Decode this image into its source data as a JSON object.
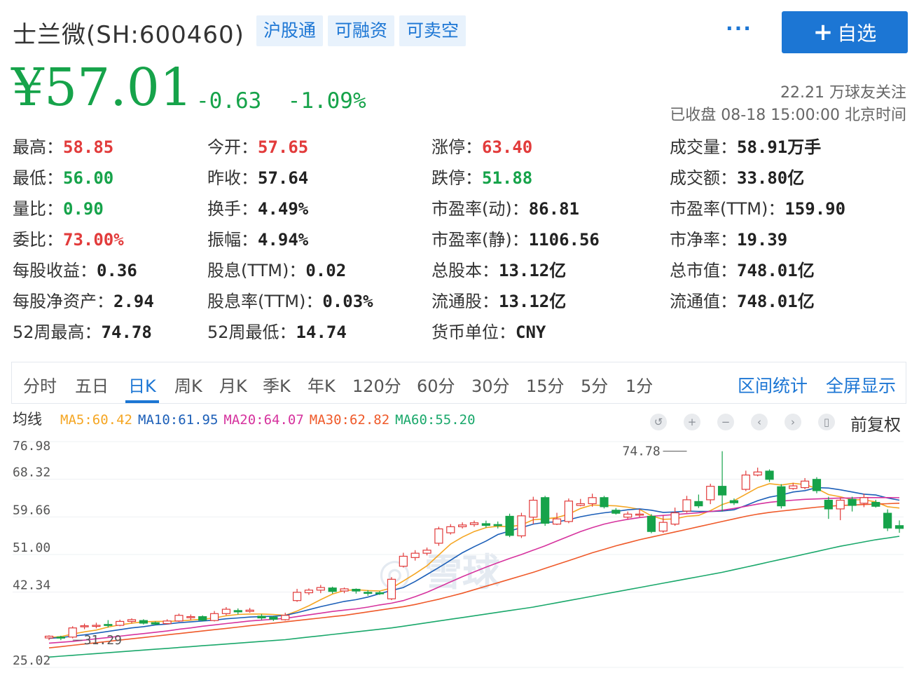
{
  "header": {
    "title": "士兰微(SH:600460)",
    "tags": [
      "沪股通",
      "可融资",
      "可卖空"
    ],
    "more_label": "···",
    "follow_button": "自选",
    "follow_icon": "+"
  },
  "quote": {
    "price": "¥57.01",
    "change": "-0.63",
    "change_pct": "-1.09%",
    "followers": "22.21 万球友关注",
    "status": "已收盘 08-18 15:00:00 北京时间"
  },
  "stats": [
    [
      {
        "label": "最高：",
        "value": "58.85",
        "color": "red"
      },
      {
        "label": "今开：",
        "value": "57.65",
        "color": "red"
      },
      {
        "label": "涨停：",
        "value": "63.40",
        "color": "red"
      },
      {
        "label": "成交量：",
        "value": "58.91万手",
        "color": "dark"
      }
    ],
    [
      {
        "label": "最低：",
        "value": "56.00",
        "color": "green"
      },
      {
        "label": "昨收：",
        "value": "57.64",
        "color": "dark"
      },
      {
        "label": "跌停：",
        "value": "51.88",
        "color": "green"
      },
      {
        "label": "成交额：",
        "value": "33.80亿",
        "color": "dark"
      }
    ],
    [
      {
        "label": "量比：",
        "value": "0.90",
        "color": "green"
      },
      {
        "label": "换手：",
        "value": "4.49%",
        "color": "dark"
      },
      {
        "label": "市盈率(动)：",
        "value": "86.81",
        "color": "dark"
      },
      {
        "label": "市盈率(TTM)：",
        "value": "159.90",
        "color": "dark"
      }
    ],
    [
      {
        "label": "委比：",
        "value": "73.00%",
        "color": "red"
      },
      {
        "label": "振幅：",
        "value": "4.94%",
        "color": "dark"
      },
      {
        "label": "市盈率(静)：",
        "value": "1106.56",
        "color": "dark"
      },
      {
        "label": "市净率：",
        "value": "19.39",
        "color": "dark"
      }
    ],
    [
      {
        "label": "每股收益：",
        "value": "0.36",
        "color": "dark"
      },
      {
        "label": "股息(TTM)：",
        "value": "0.02",
        "color": "dark"
      },
      {
        "label": "总股本：",
        "value": "13.12亿",
        "color": "dark"
      },
      {
        "label": "总市值：",
        "value": "748.01亿",
        "color": "dark"
      }
    ],
    [
      {
        "label": "每股净资产：",
        "value": "2.94",
        "color": "dark"
      },
      {
        "label": "股息率(TTM)：",
        "value": "0.03%",
        "color": "dark"
      },
      {
        "label": "流通股：",
        "value": "13.12亿",
        "color": "dark"
      },
      {
        "label": "流通值：",
        "value": "748.01亿",
        "color": "dark"
      }
    ],
    [
      {
        "label": "52周最高：",
        "value": "74.78",
        "color": "dark"
      },
      {
        "label": "52周最低：",
        "value": "14.74",
        "color": "dark"
      },
      {
        "label": "货币单位：",
        "value": "CNY",
        "color": "dark"
      }
    ]
  ],
  "tabs": [
    "分时",
    "五日",
    "日K",
    "周K",
    "月K",
    "季K",
    "年K",
    "120分",
    "60分",
    "30分",
    "15分",
    "5分",
    "1分"
  ],
  "active_tab": "日K",
  "tab_links": [
    "区间统计",
    "全屏显示"
  ],
  "ma_bar": {
    "label": "均线",
    "items": [
      {
        "text": "MA5:60.42",
        "color": "#f5a623"
      },
      {
        "text": "MA10:61.95",
        "color": "#1c5fb8"
      },
      {
        "text": "MA20:64.07",
        "color": "#d6339e"
      },
      {
        "text": "MA30:62.82",
        "color": "#ef5a2a"
      },
      {
        "text": "MA60:55.20",
        "color": "#1aa86b"
      }
    ]
  },
  "chart_controls": [
    "undo-icon",
    "zoom-in-icon",
    "zoom-out-icon",
    "left-icon",
    "right-icon",
    "fullscreen-icon"
  ],
  "adjust_label": "前复权",
  "watermark": "雪球",
  "chart_data": {
    "type": "candlestick",
    "y_ticks": [
      "76.98",
      "68.32",
      "59.66",
      "51.00",
      "42.34",
      "25.02"
    ],
    "ylim": [
      25.02,
      76.98
    ],
    "annotations": [
      {
        "text": "74.78",
        "value": 74.78,
        "index": 54
      },
      {
        "text": "31.29",
        "value": 31.29,
        "index": 2
      }
    ],
    "candles": [
      [
        31.8,
        32.2,
        31.3,
        32.4
      ],
      [
        32.0,
        31.9,
        31.29,
        32.3
      ],
      [
        32.0,
        34.1,
        31.7,
        34.5
      ],
      [
        34.4,
        34.6,
        33.8,
        35.1
      ],
      [
        34.6,
        34.7,
        34.0,
        35.3
      ],
      [
        34.9,
        34.8,
        34.2,
        35.9
      ],
      [
        34.7,
        35.6,
        34.5,
        36.0
      ],
      [
        35.6,
        36.0,
        35.1,
        36.3
      ],
      [
        35.8,
        35.2,
        34.9,
        36.1
      ],
      [
        35.3,
        35.0,
        34.7,
        35.6
      ],
      [
        35.1,
        35.7,
        34.9,
        36.1
      ],
      [
        35.7,
        37.0,
        35.5,
        37.4
      ],
      [
        36.6,
        36.7,
        35.9,
        37.2
      ],
      [
        36.7,
        35.9,
        35.6,
        37.0
      ],
      [
        35.8,
        37.4,
        35.6,
        38.0
      ],
      [
        37.4,
        38.4,
        37.0,
        38.9
      ],
      [
        38.1,
        37.8,
        37.2,
        38.6
      ],
      [
        37.9,
        38.2,
        37.6,
        38.7
      ],
      [
        36.8,
        36.4,
        35.9,
        37.3
      ],
      [
        36.6,
        36.1,
        35.7,
        36.9
      ],
      [
        36.0,
        37.0,
        35.8,
        37.6
      ],
      [
        40.4,
        42.3,
        40.1,
        43.1
      ],
      [
        42.2,
        42.8,
        41.7,
        43.2
      ],
      [
        42.8,
        43.4,
        42.1,
        44.0
      ],
      [
        43.3,
        42.5,
        42.0,
        43.6
      ],
      [
        42.6,
        43.1,
        42.1,
        43.4
      ],
      [
        43.0,
        42.6,
        42.0,
        43.2
      ],
      [
        42.3,
        42.2,
        41.5,
        42.8
      ],
      [
        42.2,
        42.0,
        41.7,
        42.6
      ],
      [
        40.8,
        45.3,
        40.5,
        45.8
      ],
      [
        48.3,
        50.6,
        48.0,
        51.4
      ],
      [
        50.3,
        51.3,
        49.6,
        52.0
      ],
      [
        51.3,
        52.0,
        50.8,
        52.6
      ],
      [
        53.6,
        56.9,
        53.0,
        57.4
      ],
      [
        56.0,
        57.4,
        55.6,
        58.0
      ],
      [
        57.4,
        57.8,
        57.0,
        58.4
      ],
      [
        57.9,
        58.3,
        57.4,
        58.8
      ],
      [
        58.1,
        57.7,
        57.2,
        58.8
      ],
      [
        57.9,
        57.7,
        57.0,
        58.6
      ],
      [
        59.8,
        55.4,
        55.0,
        60.4
      ],
      [
        55.3,
        59.9,
        54.8,
        60.6
      ],
      [
        59.6,
        63.5,
        58.0,
        64.3
      ],
      [
        64.1,
        58.2,
        57.6,
        64.5
      ],
      [
        58.0,
        59.2,
        57.8,
        60.6
      ],
      [
        58.6,
        63.3,
        58.2,
        63.9
      ],
      [
        62.3,
        62.7,
        62.1,
        63.8
      ],
      [
        62.7,
        64.1,
        62.0,
        65.0
      ],
      [
        64.1,
        62.0,
        61.6,
        64.5
      ],
      [
        61.2,
        60.5,
        60.2,
        61.7
      ],
      [
        59.6,
        60.3,
        59.1,
        60.9
      ],
      [
        60.1,
        60.3,
        59.6,
        61.5
      ],
      [
        59.8,
        56.3,
        55.9,
        60.3
      ],
      [
        56.4,
        58.4,
        56.0,
        60.0
      ],
      [
        58.0,
        60.6,
        57.6,
        61.8
      ],
      [
        61.0,
        63.6,
        60.6,
        64.5
      ],
      [
        63.2,
        62.2,
        61.7,
        64.8
      ],
      [
        63.6,
        66.7,
        62.6,
        67.3
      ],
      [
        66.7,
        64.7,
        60.9,
        74.78
      ],
      [
        63.4,
        62.9,
        62.4,
        63.9
      ],
      [
        66.0,
        69.3,
        65.6,
        70.3
      ],
      [
        69.3,
        70.0,
        69.0,
        71.0
      ],
      [
        70.2,
        68.3,
        67.7,
        70.6
      ],
      [
        66.6,
        62.2,
        61.6,
        67.2
      ],
      [
        66.2,
        66.8,
        65.9,
        67.5
      ],
      [
        66.4,
        67.9,
        66.0,
        68.6
      ],
      [
        68.3,
        65.7,
        65.1,
        68.8
      ],
      [
        63.5,
        61.5,
        59.2,
        64.3
      ],
      [
        61.5,
        63.5,
        58.9,
        64.1
      ],
      [
        63.7,
        62.3,
        60.9,
        64.3
      ],
      [
        62.8,
        64.1,
        61.9,
        65.0
      ],
      [
        63.0,
        62.1,
        61.8,
        63.6
      ],
      [
        60.5,
        57.1,
        56.4,
        61.4
      ],
      [
        57.65,
        57.01,
        56.0,
        58.85
      ]
    ],
    "ma_series": [
      {
        "name": "MA5",
        "color": "#f5a623",
        "values": [
          31.9,
          32.1,
          32.7,
          33.2,
          33.6,
          34.3,
          34.8,
          35.2,
          35.5,
          35.6,
          35.6,
          35.7,
          35.9,
          36.1,
          36.4,
          36.9,
          37.2,
          37.3,
          37.3,
          37.2,
          37.0,
          38.0,
          39.2,
          40.6,
          41.9,
          42.7,
          42.9,
          42.7,
          42.6,
          43.3,
          44.9,
          46.6,
          48.4,
          50.9,
          53.4,
          55.0,
          56.3,
          57.2,
          57.5,
          57.4,
          57.8,
          59.0,
          59.2,
          59.5,
          60.3,
          61.6,
          62.4,
          62.3,
          62.2,
          61.9,
          61.4,
          59.9,
          59.1,
          59.2,
          59.8,
          60.0,
          61.1,
          62.5,
          63.4,
          64.9,
          66.4,
          67.3,
          67.0,
          67.4,
          67.1,
          66.2,
          64.8,
          64.3,
          63.6,
          63.6,
          63.1,
          62.0,
          61.7
        ]
      },
      {
        "name": "MA10",
        "color": "#1c5fb8",
        "values": [
          31.7,
          31.9,
          32.2,
          32.5,
          32.9,
          33.3,
          33.7,
          34.1,
          34.4,
          34.8,
          35.0,
          35.3,
          35.5,
          35.7,
          35.9,
          36.2,
          36.4,
          36.6,
          36.7,
          36.8,
          37.0,
          37.6,
          38.3,
          39.0,
          39.6,
          40.2,
          40.6,
          41.2,
          42.0,
          42.7,
          43.4,
          44.8,
          46.4,
          48.0,
          49.7,
          51.4,
          52.8,
          54.1,
          55.6,
          56.4,
          57.2,
          58.0,
          58.4,
          58.5,
          59.0,
          59.7,
          60.2,
          60.6,
          60.9,
          61.3,
          61.5,
          61.2,
          60.7,
          60.8,
          61.0,
          60.9,
          60.9,
          61.0,
          61.3,
          62.3,
          63.4,
          64.2,
          64.7,
          65.4,
          65.7,
          66.4,
          66.3,
          65.9,
          65.4,
          64.9,
          64.7,
          64.0,
          63.5
        ]
      },
      {
        "name": "MA20",
        "color": "#d6339e",
        "values": [
          30.6,
          30.8,
          31.0,
          31.3,
          31.6,
          31.9,
          32.2,
          32.5,
          32.8,
          33.1,
          33.4,
          33.8,
          34.1,
          34.5,
          34.8,
          35.1,
          35.4,
          35.7,
          35.9,
          36.1,
          36.3,
          36.7,
          37.1,
          37.5,
          37.9,
          38.2,
          38.5,
          38.9,
          39.4,
          39.8,
          40.4,
          41.3,
          42.3,
          43.5,
          44.7,
          45.9,
          47.0,
          48.1,
          49.1,
          50.1,
          51.0,
          52.0,
          53.0,
          54.1,
          55.2,
          56.3,
          57.2,
          58.0,
          58.6,
          59.1,
          59.5,
          59.8,
          60.0,
          60.2,
          60.4,
          60.6,
          60.9,
          61.2,
          61.6,
          62.1,
          62.6,
          63.0,
          63.3,
          63.5,
          63.7,
          63.8,
          63.9,
          64.0,
          64.0,
          64.1,
          64.1,
          64.1,
          64.07
        ]
      },
      {
        "name": "MA30",
        "color": "#ef5a2a",
        "values": [
          29.5,
          29.8,
          30.1,
          30.4,
          30.7,
          31.0,
          31.3,
          31.6,
          31.9,
          32.2,
          32.5,
          32.8,
          33.1,
          33.4,
          33.7,
          34.0,
          34.3,
          34.6,
          34.9,
          35.2,
          35.5,
          35.8,
          36.1,
          36.4,
          36.7,
          37.0,
          37.4,
          37.8,
          38.2,
          38.6,
          39.0,
          39.5,
          40.1,
          40.7,
          41.4,
          42.1,
          42.9,
          43.7,
          44.5,
          45.3,
          46.1,
          46.9,
          47.8,
          48.7,
          49.6,
          50.5,
          51.4,
          52.2,
          53.0,
          53.7,
          54.4,
          55.0,
          55.6,
          56.2,
          56.8,
          57.4,
          58.0,
          58.6,
          59.2,
          59.8,
          60.3,
          60.7,
          61.0,
          61.3,
          61.6,
          61.9,
          62.1,
          62.3,
          62.4,
          62.5,
          62.6,
          62.7,
          62.82
        ]
      },
      {
        "name": "MA60",
        "color": "#1aa86b",
        "values": [
          27.4,
          27.6,
          27.8,
          28.0,
          28.2,
          28.4,
          28.6,
          28.8,
          29.0,
          29.2,
          29.4,
          29.6,
          29.8,
          30.0,
          30.2,
          30.4,
          30.6,
          30.8,
          31.0,
          31.2,
          31.4,
          31.7,
          32.0,
          32.3,
          32.6,
          32.9,
          33.2,
          33.5,
          33.8,
          34.1,
          34.5,
          34.9,
          35.3,
          35.7,
          36.1,
          36.5,
          36.9,
          37.3,
          37.7,
          38.1,
          38.5,
          38.9,
          39.4,
          39.9,
          40.4,
          40.9,
          41.4,
          41.9,
          42.4,
          42.9,
          43.4,
          43.9,
          44.4,
          44.9,
          45.4,
          45.9,
          46.4,
          46.9,
          47.5,
          48.1,
          48.7,
          49.3,
          49.9,
          50.5,
          51.1,
          51.7,
          52.3,
          52.9,
          53.4,
          53.9,
          54.4,
          54.8,
          55.2
        ]
      }
    ]
  }
}
